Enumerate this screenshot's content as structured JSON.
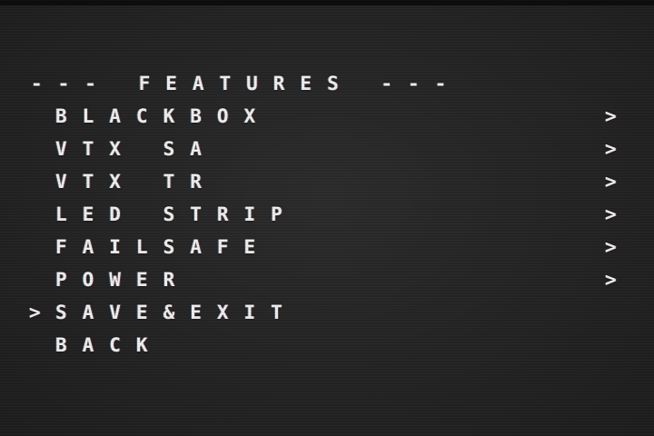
{
  "menu": {
    "title": "--- FEATURES ---",
    "items": [
      {
        "label": "BLACKBOX",
        "arrow": ">"
      },
      {
        "label": "VTX SA",
        "arrow": ">"
      },
      {
        "label": "VTX TR",
        "arrow": ">"
      },
      {
        "label": "LED STRIP",
        "arrow": ">"
      },
      {
        "label": "FAILSAFE",
        "arrow": ">"
      },
      {
        "label": "POWER",
        "arrow": ">"
      },
      {
        "label": "SAVE&EXIT",
        "arrow": ""
      },
      {
        "label": "BACK",
        "arrow": ""
      }
    ],
    "cursor": ">",
    "selected_index": 6
  }
}
